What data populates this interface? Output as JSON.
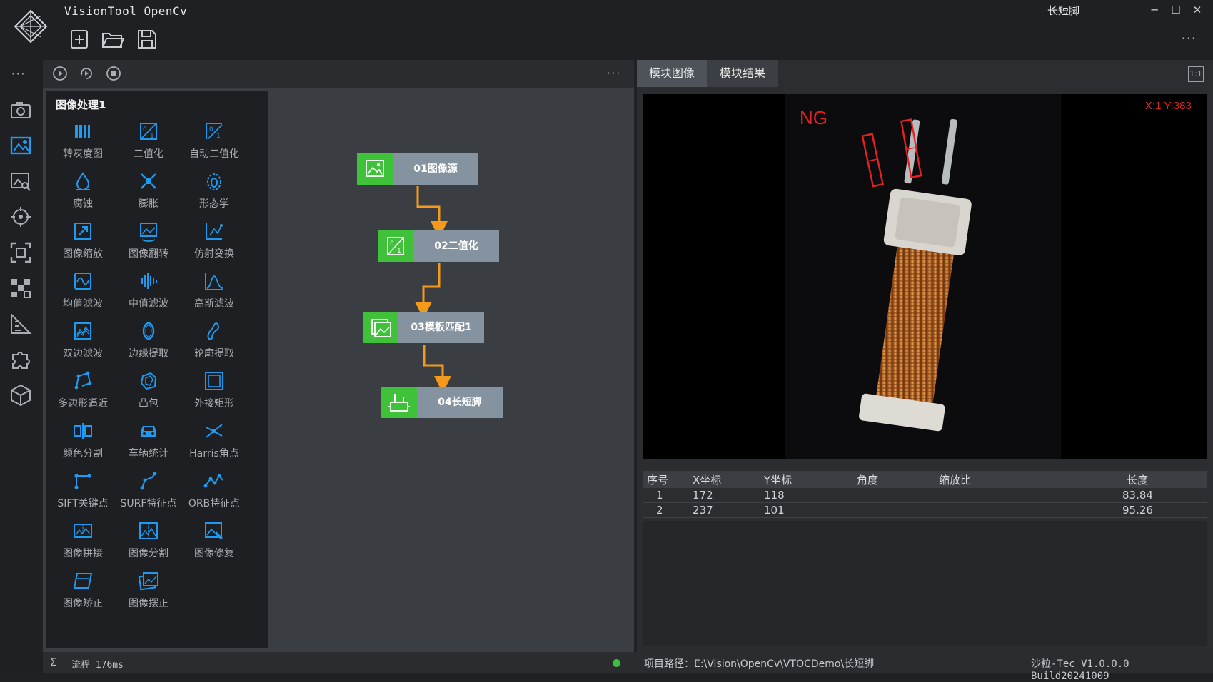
{
  "app": {
    "title": "VisionTool OpenCv",
    "project_name": "长短脚",
    "window_buttons": [
      "minimize-icon",
      "maximize-icon",
      "close-icon"
    ]
  },
  "toolbar": {
    "icons": [
      "new-file-icon",
      "open-folder-icon",
      "save-icon"
    ]
  },
  "rail": {
    "icons": [
      "camera-icon",
      "image-process-icon",
      "image-analysis-icon",
      "target-icon",
      "focus-icon",
      "pattern-icon",
      "measure-icon",
      "plugin-icon",
      "cube-icon"
    ]
  },
  "center_toolbar": {
    "icons": [
      "run-once-icon",
      "run-loop-icon",
      "stop-icon"
    ]
  },
  "palette": {
    "title": "图像处理1",
    "tools": [
      {
        "label": "转灰度图",
        "icon": "grayscale-icon"
      },
      {
        "label": "二值化",
        "icon": "binarize-icon"
      },
      {
        "label": "自动二值化",
        "icon": "auto-binarize-icon"
      },
      {
        "label": "腐蚀",
        "icon": "erode-icon"
      },
      {
        "label": "膨胀",
        "icon": "dilate-icon"
      },
      {
        "label": "形态学",
        "icon": "morphology-icon"
      },
      {
        "label": "图像缩放",
        "icon": "resize-icon"
      },
      {
        "label": "图像翻转",
        "icon": "flip-icon"
      },
      {
        "label": "仿射变换",
        "icon": "affine-icon"
      },
      {
        "label": "均值滤波",
        "icon": "mean-filter-icon"
      },
      {
        "label": "中值滤波",
        "icon": "median-filter-icon"
      },
      {
        "label": "高斯滤波",
        "icon": "gaussian-filter-icon"
      },
      {
        "label": "双边滤波",
        "icon": "bilateral-filter-icon"
      },
      {
        "label": "边缘提取",
        "icon": "edge-icon"
      },
      {
        "label": "轮廓提取",
        "icon": "contour-icon"
      },
      {
        "label": "多边形逼近",
        "icon": "polygon-icon"
      },
      {
        "label": "凸包",
        "icon": "convex-hull-icon"
      },
      {
        "label": "外接矩形",
        "icon": "bounding-rect-icon"
      },
      {
        "label": "颜色分割",
        "icon": "color-split-icon"
      },
      {
        "label": "车辆统计",
        "icon": "vehicle-icon"
      },
      {
        "label": "Harris角点",
        "icon": "harris-icon"
      },
      {
        "label": "SIFT关键点",
        "icon": "sift-icon"
      },
      {
        "label": "SURF特征点",
        "icon": "surf-icon"
      },
      {
        "label": "ORB特征点",
        "icon": "orb-icon"
      },
      {
        "label": "图像拼接",
        "icon": "stitch-icon"
      },
      {
        "label": "图像分割",
        "icon": "segment-icon"
      },
      {
        "label": "图像修复",
        "icon": "inpaint-icon"
      },
      {
        "label": "图像矫正",
        "icon": "rectify-icon"
      },
      {
        "label": "图像摆正",
        "icon": "deskew-icon"
      }
    ]
  },
  "flow": {
    "nodes": [
      {
        "label": "01图像源",
        "icon": "image-source-icon"
      },
      {
        "label": "02二值化",
        "icon": "binarize-icon"
      },
      {
        "label": "03模板匹配1",
        "icon": "template-match-icon"
      },
      {
        "label": "04长短脚",
        "icon": "pin-measure-icon"
      }
    ]
  },
  "right_panel": {
    "tabs": [
      "模块图像",
      "模块结果"
    ],
    "scale_button": "1:1",
    "viewer": {
      "status": "NG",
      "coords": "X:1 Y:383"
    },
    "table": {
      "headers": [
        "序号",
        "X坐标",
        "Y坐标",
        "角度",
        "缩放比",
        "长度"
      ],
      "rows": [
        [
          "1",
          "172",
          "118",
          "",
          "",
          "83.84"
        ],
        [
          "2",
          "237",
          "101",
          "",
          "",
          "95.26"
        ]
      ]
    }
  },
  "status_bar": {
    "sigma": "Σ",
    "flow_time": "流程 176ms",
    "project_path": "项目路径：E:\\Vision\\OpenCv\\VTOCDemo\\长短脚",
    "version": "沙粒-Tec V1.0.0.0 Build20241009"
  },
  "colors": {
    "accent_blue": "#1e9bf0",
    "node_green": "#3fc13a",
    "flow_arrow": "#f39a1d",
    "ng_red": "#e52222"
  }
}
